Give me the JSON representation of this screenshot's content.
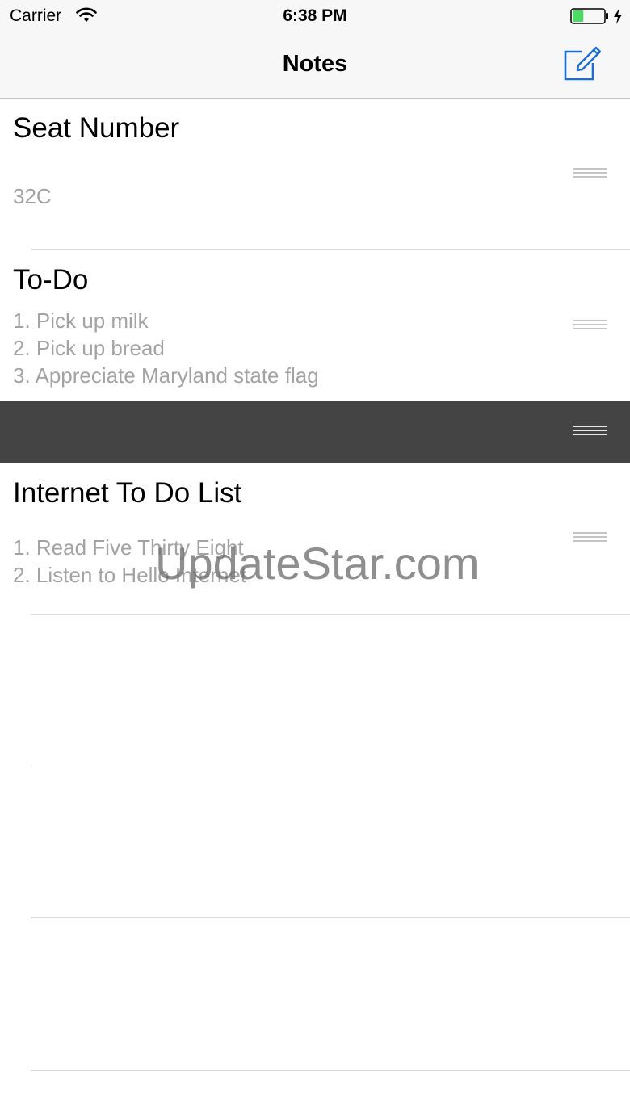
{
  "status_bar": {
    "carrier": "Carrier",
    "time": "6:38 PM",
    "wifi_icon": "wifi-icon",
    "battery_icon": "battery-icon",
    "battery_level": 0.35,
    "battery_color": "#4cd964",
    "charging_icon": "charging-bolt-icon"
  },
  "nav_bar": {
    "title": "Notes",
    "compose_icon": "compose-icon",
    "accent_color": "#1a6fd6"
  },
  "notes": [
    {
      "title": "Seat Number",
      "body": "32C"
    },
    {
      "title": "To-Do",
      "body": "1. Pick up milk\n2. Pick up bread\n3. Appreciate Maryland state flag"
    },
    {
      "title": "Internet To Do List",
      "body": "1. Read Five Thirty Eight\n2. Listen to Hello Internet"
    }
  ],
  "reorder_icon": "reorder-handle-icon",
  "watermark": "UpdateStar.com"
}
